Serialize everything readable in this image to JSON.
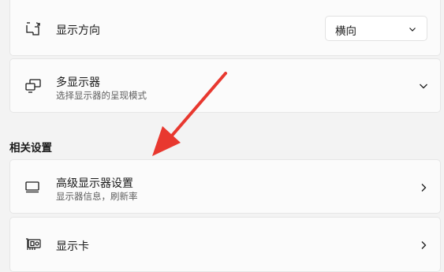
{
  "settings": {
    "orientation": {
      "title": "显示方向",
      "icon": "display-orientation-icon",
      "dropdown_value": "横向"
    },
    "multi_display": {
      "title": "多显示器",
      "subtitle": "选择显示器的呈现模式",
      "icon": "multi-display-icon"
    }
  },
  "related": {
    "heading": "相关设置",
    "advanced_display": {
      "title": "高级显示器设置",
      "subtitle": "显示器信息，刷新率",
      "icon": "monitor-icon"
    },
    "graphics": {
      "title": "显示卡",
      "icon": "graphics-card-icon"
    }
  },
  "annotation": {
    "arrow_color": "#e8382f"
  }
}
